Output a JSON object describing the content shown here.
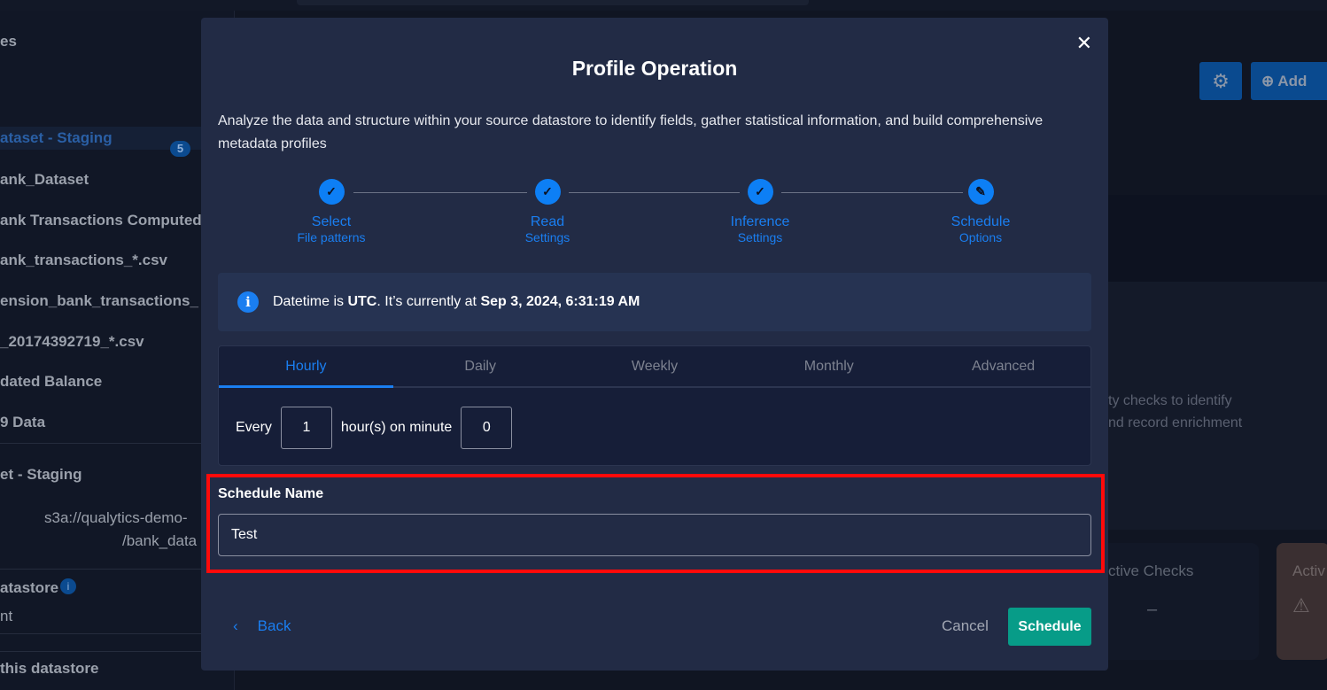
{
  "background": {
    "sidebar": {
      "items": [
        "es",
        "ataset - Staging",
        "ank_Dataset",
        "ank Transactions Computed Fil",
        "ank_transactions_*.csv",
        "ension_bank_transactions_",
        "_20174392719_*.csv",
        "dated Balance",
        "9 Data",
        "et - Staging",
        "s3a://qualytics-demo-",
        "/bank_data",
        "atastore",
        "nt",
        "this datastore"
      ],
      "active_badge": "5"
    },
    "add_label": "Add",
    "description_lines": [
      "ty checks to identify",
      "nd record enrichment"
    ],
    "card1_label": "ctive Checks",
    "card1_value": "–",
    "card2_label": "Activ"
  },
  "modal": {
    "title": "Profile Operation",
    "description": "Analyze the data and structure within your source datastore to identify fields, gather statistical information, and build comprehensive metadata profiles",
    "steps": [
      {
        "title": "Select",
        "subtitle": "File patterns",
        "state": "done"
      },
      {
        "title": "Read",
        "subtitle": "Settings",
        "state": "done"
      },
      {
        "title": "Inference",
        "subtitle": "Settings",
        "state": "done"
      },
      {
        "title": "Schedule",
        "subtitle": "Options",
        "state": "current"
      }
    ],
    "info": {
      "prefix": "Datetime is ",
      "tz": "UTC",
      "middle": ". It’s currently at ",
      "datetime": "Sep 3, 2024, 6:31:19 AM"
    },
    "tabs": [
      "Hourly",
      "Daily",
      "Weekly",
      "Monthly",
      "Advanced"
    ],
    "active_tab": "Hourly",
    "every_label": "Every",
    "hours_value": "1",
    "mid_label": "hour(s) on minute",
    "minute_value": "0",
    "schedule_name_label": "Schedule Name",
    "schedule_name_value": "Test",
    "back_label": "Back",
    "cancel_label": "Cancel",
    "schedule_label": "Schedule"
  },
  "colors": {
    "accent": "#1a7ef0",
    "primary_button": "#079c88",
    "highlight": "#ff0a0a",
    "modal_bg": "#222b45"
  }
}
